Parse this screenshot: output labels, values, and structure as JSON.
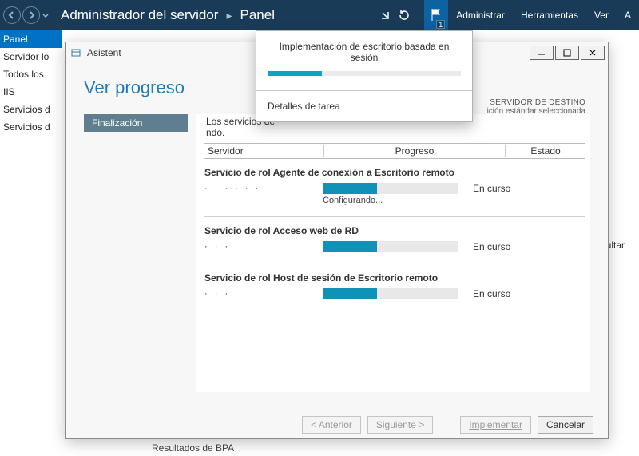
{
  "header": {
    "breadcrumb_app": "Administrador del servidor",
    "breadcrumb_page": "Panel",
    "flag_count": "1",
    "menu_admin": "Administrar",
    "menu_tools": "Herramientas",
    "menu_view": "Ver",
    "menu_help": "A"
  },
  "sidebar": {
    "items": [
      "Panel",
      "Servidor lo",
      "Todos los",
      "IIS",
      "Servicios d",
      "Servicios d"
    ]
  },
  "wizard": {
    "title_prefix": "Asistent",
    "heading": "Ver progreso",
    "target_label": "SERVIDOR DE DESTINO",
    "target_sub": "ición estándar seleccionada",
    "step_label": "Finalización",
    "intro_prefix": "Los servicios de",
    "intro_suffix": "ndo.",
    "columns": {
      "server": "Servidor",
      "progress": "Progreso",
      "state": "Estado"
    },
    "services": [
      {
        "title": "Servicio de rol Agente de conexión a Escritorio remoto",
        "server_mask": "· · ·   ·   · ·",
        "status": "En curso",
        "substatus": "Configurando...",
        "progress_pct": 40
      },
      {
        "title": "Servicio de rol Acceso web de RD",
        "server_mask": "·        ·   ·",
        "status": "En curso",
        "substatus": "",
        "progress_pct": 40
      },
      {
        "title": "Servicio de rol Host de sesión de Escritorio remoto",
        "server_mask": "· ·       ·",
        "status": "En curso",
        "substatus": "",
        "progress_pct": 40
      }
    ],
    "buttons": {
      "prev": "< Anterior",
      "next": "Siguiente >",
      "deploy": "Implementar",
      "cancel": "Cancelar"
    }
  },
  "toast": {
    "title": "Implementación de escritorio basada en sesión",
    "progress_pct": 28,
    "detail_link": "Detalles de tarea"
  },
  "base": {
    "ocultar": "Ocultar",
    "bpa": "Resultados de BPA"
  }
}
